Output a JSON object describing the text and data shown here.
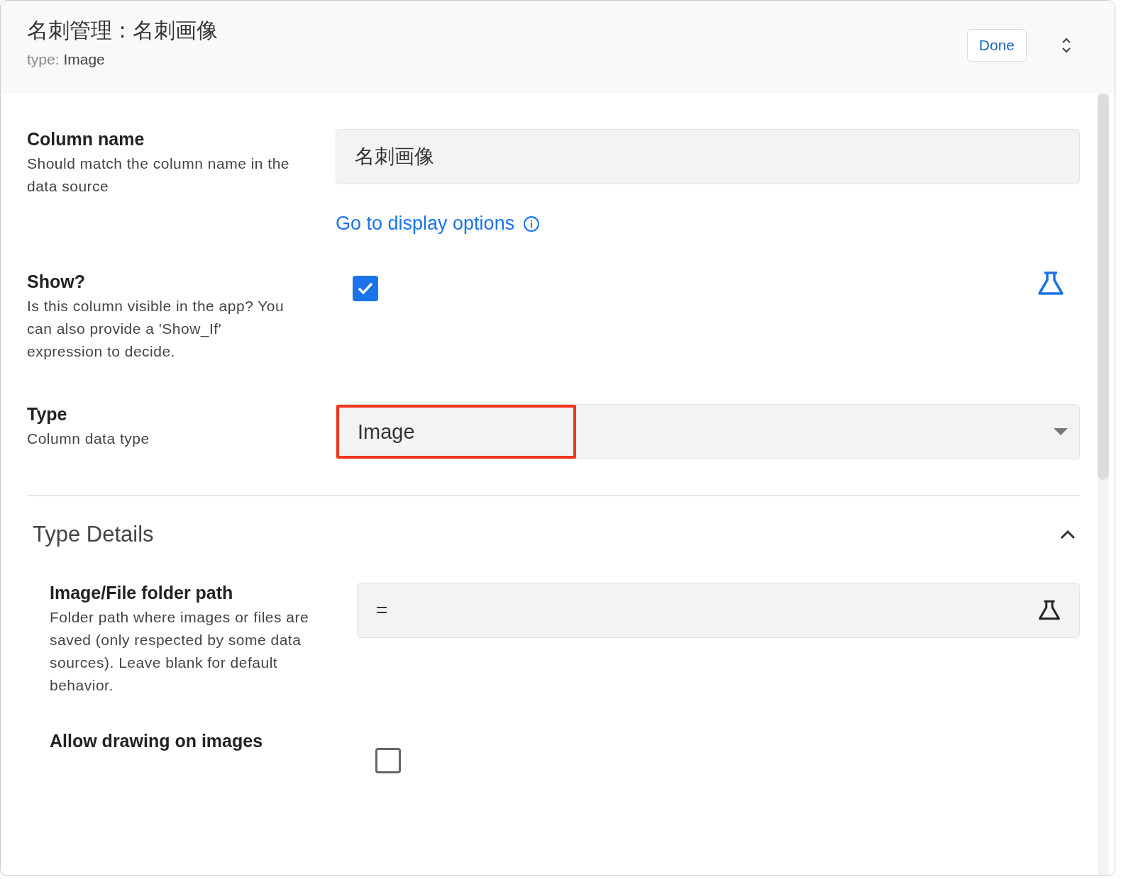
{
  "header": {
    "title": "名刺管理 : 名刺画像",
    "type_label": "type:",
    "type_value": "Image",
    "done_button": "Done"
  },
  "column_name": {
    "label": "Column name",
    "description": "Should match the column name in the data source",
    "value": "名刺画像",
    "link": "Go to display options"
  },
  "show": {
    "label": "Show?",
    "description": "Is this column visible in the app? You can also provide a 'Show_If' expression to decide.",
    "checked": true
  },
  "type": {
    "label": "Type",
    "description": "Column data type",
    "value": "Image",
    "highlighted": true
  },
  "type_details": {
    "title": "Type Details",
    "expanded": true,
    "folder_path": {
      "label": "Image/File folder path",
      "description": "Folder path where images or files are saved (only respected by some data sources). Leave blank for default behavior.",
      "value": "="
    },
    "allow_drawing": {
      "label": "Allow drawing on images",
      "checked": false
    }
  }
}
